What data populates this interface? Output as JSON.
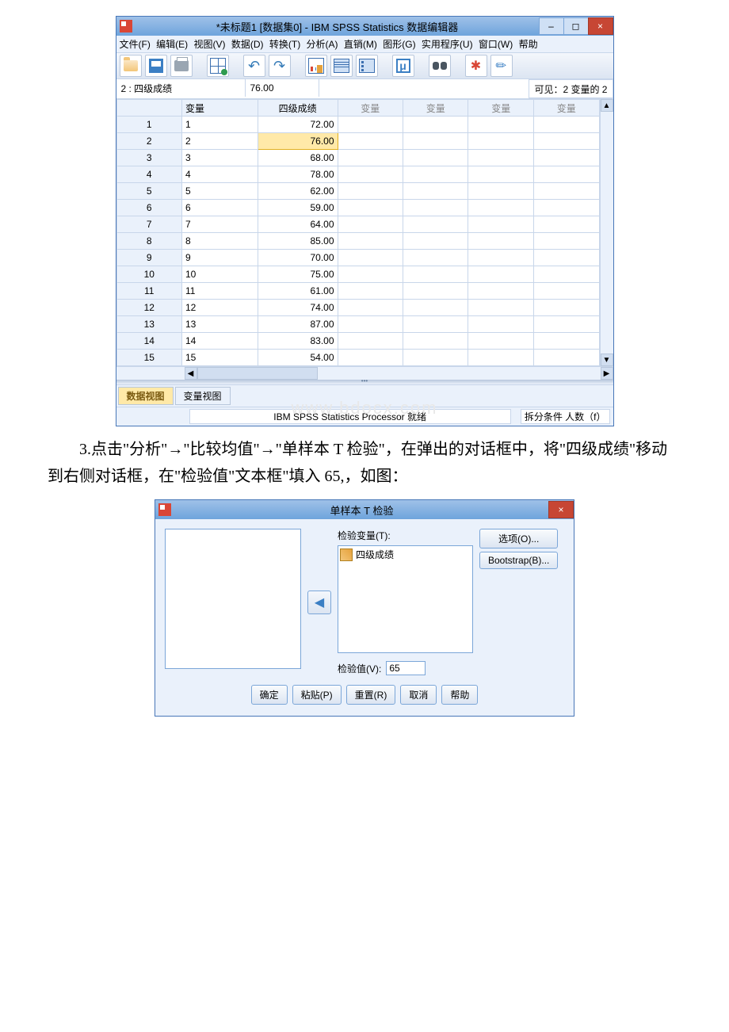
{
  "spss": {
    "title": "*未标题1 [数据集0] - IBM SPSS Statistics 数据编辑器",
    "menu": {
      "file": "文件(F)",
      "edit": "编辑(E)",
      "view": "视图(V)",
      "data": "数据(D)",
      "transform": "转换(T)",
      "analyze": "分析(A)",
      "direct": "直销(M)",
      "graphs": "图形(G)",
      "util": "实用程序(U)",
      "window": "窗口(W)",
      "help": "帮助"
    },
    "info": {
      "cell_label": "2 : 四级成绩",
      "cell_value": "76.00",
      "visible": "可见：2 变量的 2"
    },
    "columns": {
      "var": "变量",
      "score": "四级成绩",
      "v1": "变量",
      "v2": "变量",
      "v3": "变量",
      "v4": "变量"
    },
    "rows": [
      {
        "n": "1",
        "v": "1",
        "s": "72.00"
      },
      {
        "n": "2",
        "v": "2",
        "s": "76.00",
        "sel": true
      },
      {
        "n": "3",
        "v": "3",
        "s": "68.00"
      },
      {
        "n": "4",
        "v": "4",
        "s": "78.00"
      },
      {
        "n": "5",
        "v": "5",
        "s": "62.00"
      },
      {
        "n": "6",
        "v": "6",
        "s": "59.00"
      },
      {
        "n": "7",
        "v": "7",
        "s": "64.00"
      },
      {
        "n": "8",
        "v": "8",
        "s": "85.00"
      },
      {
        "n": "9",
        "v": "9",
        "s": "70.00"
      },
      {
        "n": "10",
        "v": "10",
        "s": "75.00"
      },
      {
        "n": "11",
        "v": "11",
        "s": "61.00"
      },
      {
        "n": "12",
        "v": "12",
        "s": "74.00"
      },
      {
        "n": "13",
        "v": "13",
        "s": "87.00"
      },
      {
        "n": "14",
        "v": "14",
        "s": "83.00"
      },
      {
        "n": "15",
        "v": "15",
        "s": "54.00"
      }
    ],
    "tabs": {
      "data": "数据视图",
      "var": "变量视图"
    },
    "status": {
      "processor": "IBM SPSS Statistics Processor 就绪",
      "split": "拆分条件 人数（f）"
    },
    "watermark": "www.bdocx.com"
  },
  "paragraph": "3.点击\"分析\"→\"比较均值\"→\"单样本 T 检验\"，在弹出的对话框中，将\"四级成绩\"移动到右侧对话框，在\"检验值\"文本框\"填入 65,，如图：",
  "dialog": {
    "title": "单样本 T 检验",
    "test_var_label": "检验变量(T):",
    "test_var_item": "四级成绩",
    "test_value_label": "检验值(V):",
    "test_value": "65",
    "options": "选项(O)...",
    "bootstrap": "Bootstrap(B)...",
    "ok": "确定",
    "paste": "粘贴(P)",
    "reset": "重置(R)",
    "cancel": "取消",
    "help": "帮助"
  }
}
